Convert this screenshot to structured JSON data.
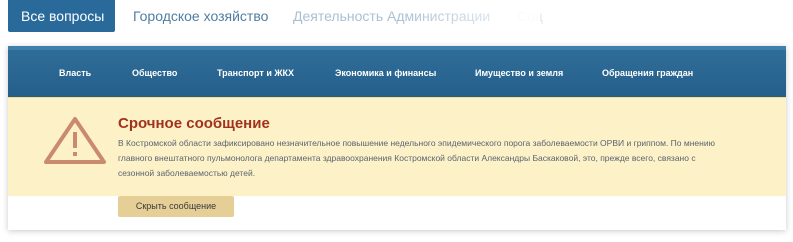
{
  "tabs": [
    {
      "label": "Все вопросы",
      "active": true
    },
    {
      "label": "Городское хозяйство",
      "active": false
    },
    {
      "label": "Деятельность Администрации",
      "active": false
    },
    {
      "label": "Соц",
      "active": false
    }
  ],
  "nav": {
    "items": [
      {
        "label": "Власть"
      },
      {
        "label": "Общество"
      },
      {
        "label": "Транспорт и ЖКХ"
      },
      {
        "label": "Экономика и финансы"
      },
      {
        "label": "Имущество и земля"
      },
      {
        "label": "Обращения граждан"
      }
    ]
  },
  "alert": {
    "icon": "warning-triangle-icon",
    "title": "Срочное сообщение",
    "text": "В Костромской области зафиксировано незначительное повышение недельного эпидемического порога заболеваемости ОРВИ и гриппом. По мнению главного внештатного пульмонолога департамента здравоохранения Костромской области Александры Баскаковой, это, прежде всего, связано с сезонной заболеваемостью детей.",
    "hide_label": "Скрыть сообщение"
  },
  "colors": {
    "accent": "#2a6a9a",
    "alert_background": "#fdf1c8",
    "alert_title": "#a1331c",
    "button_background": "#e6cf97"
  }
}
